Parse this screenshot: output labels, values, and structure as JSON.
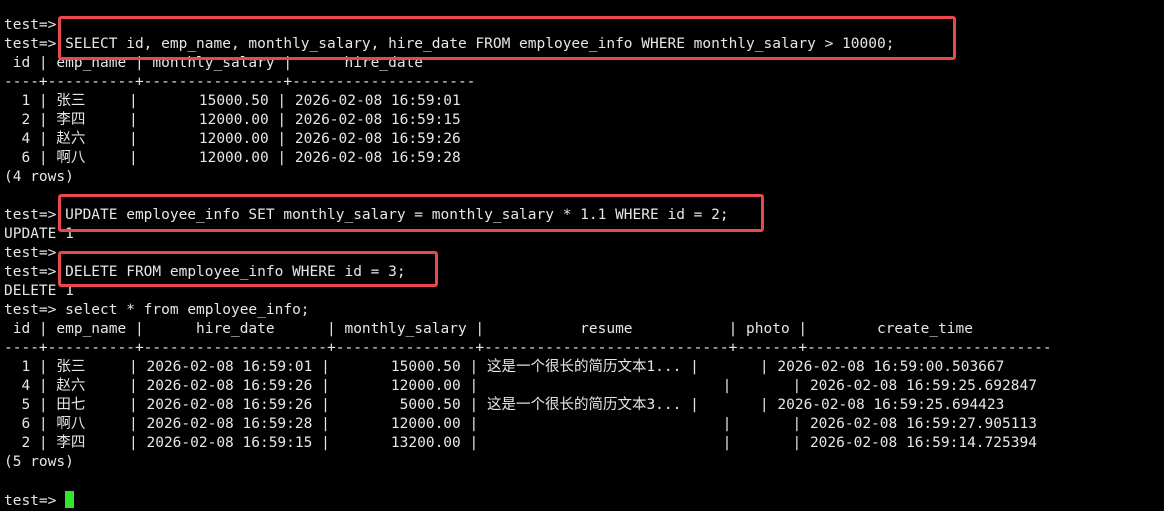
{
  "prompt": "test=> ",
  "lines": [
    "test=>",
    "test=> SELECT id, emp_name, monthly_salary, hire_date FROM employee_info WHERE monthly_salary > 10000;",
    " id | emp_name | monthly_salary |      hire_date",
    "----+----------+----------------+---------------------",
    "  1 | 张三     |       15000.50 | 2026-02-08 16:59:01",
    "  2 | 李四     |       12000.00 | 2026-02-08 16:59:15",
    "  4 | 赵六     |       12000.00 | 2026-02-08 16:59:26",
    "  6 | 啊八     |       12000.00 | 2026-02-08 16:59:28",
    "(4 rows)",
    "",
    "test=> UPDATE employee_info SET monthly_salary = monthly_salary * 1.1 WHERE id = 2;",
    "UPDATE 1",
    "test=>",
    "test=> DELETE FROM employee_info WHERE id = 3;",
    "DELETE 1",
    "test=> select * from employee_info;",
    " id | emp_name |      hire_date      | monthly_salary |           resume           | photo |        create_time",
    "----+----------+---------------------+----------------+----------------------------+-------+----------------------------",
    "  1 | 张三     | 2026-02-08 16:59:01 |       15000.50 | 这是一个很长的简历文本1... |       | 2026-02-08 16:59:00.503667",
    "  4 | 赵六     | 2026-02-08 16:59:26 |       12000.00 |                            |       | 2026-02-08 16:59:25.692847",
    "  5 | 田七     | 2026-02-08 16:59:26 |        5000.50 | 这是一个很长的简历文本3... |       | 2026-02-08 16:59:25.694423",
    "  6 | 啊八     | 2026-02-08 16:59:28 |       12000.00 |                            |       | 2026-02-08 16:59:27.905113",
    "  2 | 李四     | 2026-02-08 16:59:15 |       13200.00 |                            |       | 2026-02-08 16:59:14.725394",
    "(5 rows)",
    ""
  ],
  "colors": {
    "background": "#000000",
    "text": "#e6e6e6",
    "highlight_box": "#e8474c",
    "cursor": "#2ee62e"
  }
}
